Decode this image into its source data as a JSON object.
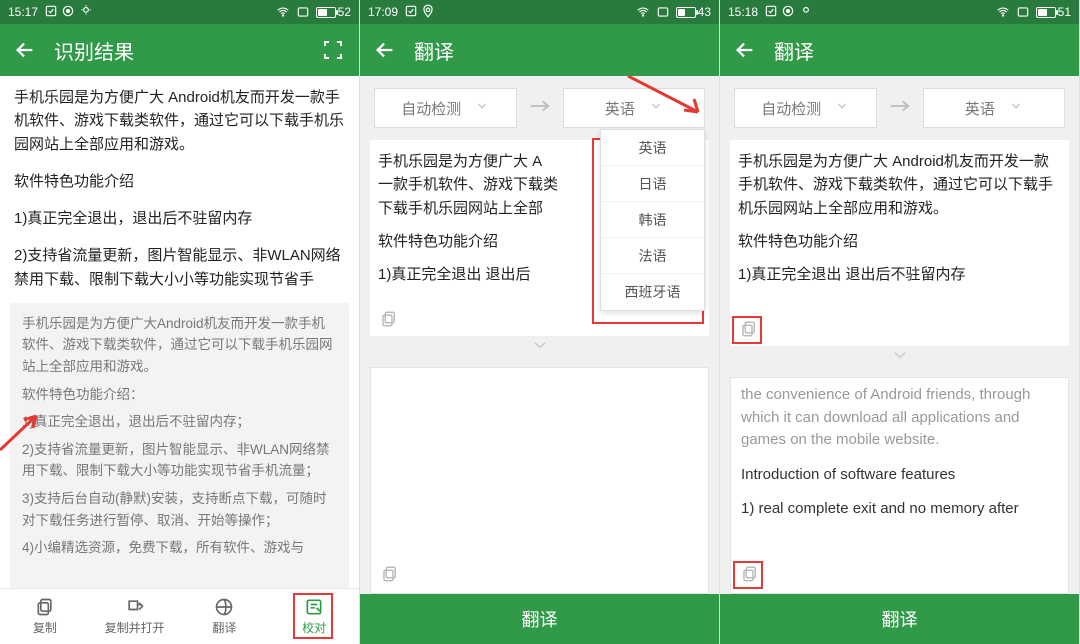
{
  "screen1": {
    "status": {
      "time": "15:17",
      "battery": "52",
      "batt_pct": 52
    },
    "header": {
      "title": "识别结果"
    },
    "text": {
      "p1": "手机乐园是为方便广大   Android机友而开发一款手机软件、游戏下载类软件，通过它可以下载手机乐园网站上全部应用和游戏。",
      "p2": "软件特色功能介绍",
      "p3": "1)真正完全退出，退出后不驻留内存",
      "p4": "2)支持省流量更新，图片智能显示、非WLAN网络禁用下载、限制下载大小小等功能实现节省手"
    },
    "panel": {
      "p1": "手机乐园是为方便广大Android机友而开发一款手机软件、游戏下载类软件，通过它可以下载手机乐园网站上全部应用和游戏。",
      "p2": "软件特色功能介绍：",
      "p3": "1)真正完全退出，退出后不驻留内存；",
      "p4": "2)支持省流量更新，图片智能显示、非WLAN网络禁用下载、限制下载大小等功能实现节省手机流量；",
      "p5": "3)支持后台自动(静默)安装，支持断点下载，可随时对下载任务进行暂停、取消、开始等操作；",
      "p6": "4)小编精选资源，免费下载，所有软件、游戏与"
    },
    "tabs": {
      "copy": "复制",
      "copy_open": "复制并打开",
      "translate": "翻译",
      "proof": "校对"
    }
  },
  "screen2": {
    "status": {
      "time": "17:09",
      "battery": "43",
      "batt_pct": 43
    },
    "header": {
      "title": "翻译"
    },
    "lang": {
      "from": "自动检测",
      "to": "英语",
      "options": [
        "英语",
        "日语",
        "韩语",
        "法语",
        "西班牙语"
      ]
    },
    "src": {
      "p1": "手机乐园是为方便广大   A",
      "p2": "一款手机软件、游戏下载类",
      "p3": "下载手机乐园网站上全部",
      "p4": "软件特色功能介绍",
      "p5": "1)真正完全退出   退出后"
    },
    "button": "翻译"
  },
  "screen3": {
    "status": {
      "time": "15:18",
      "battery": "51",
      "batt_pct": 51
    },
    "header": {
      "title": "翻译"
    },
    "lang": {
      "from": "自动检测",
      "to": "英语"
    },
    "src": {
      "p1": "手机乐园是为方便广大   Android机友而开发一款手机软件、游戏下载类软件，通过它可以下载手机乐园网站上全部应用和游戏。",
      "p2": "软件特色功能介绍",
      "p3": "1)真正完全退出   退出后不驻留内存"
    },
    "out": {
      "p0": "the convenience of Android friends, through which it can download all applications and games on the mobile website.",
      "p1": "Introduction of software features",
      "p2": "1) real complete exit and no memory after"
    },
    "button": "翻译"
  }
}
